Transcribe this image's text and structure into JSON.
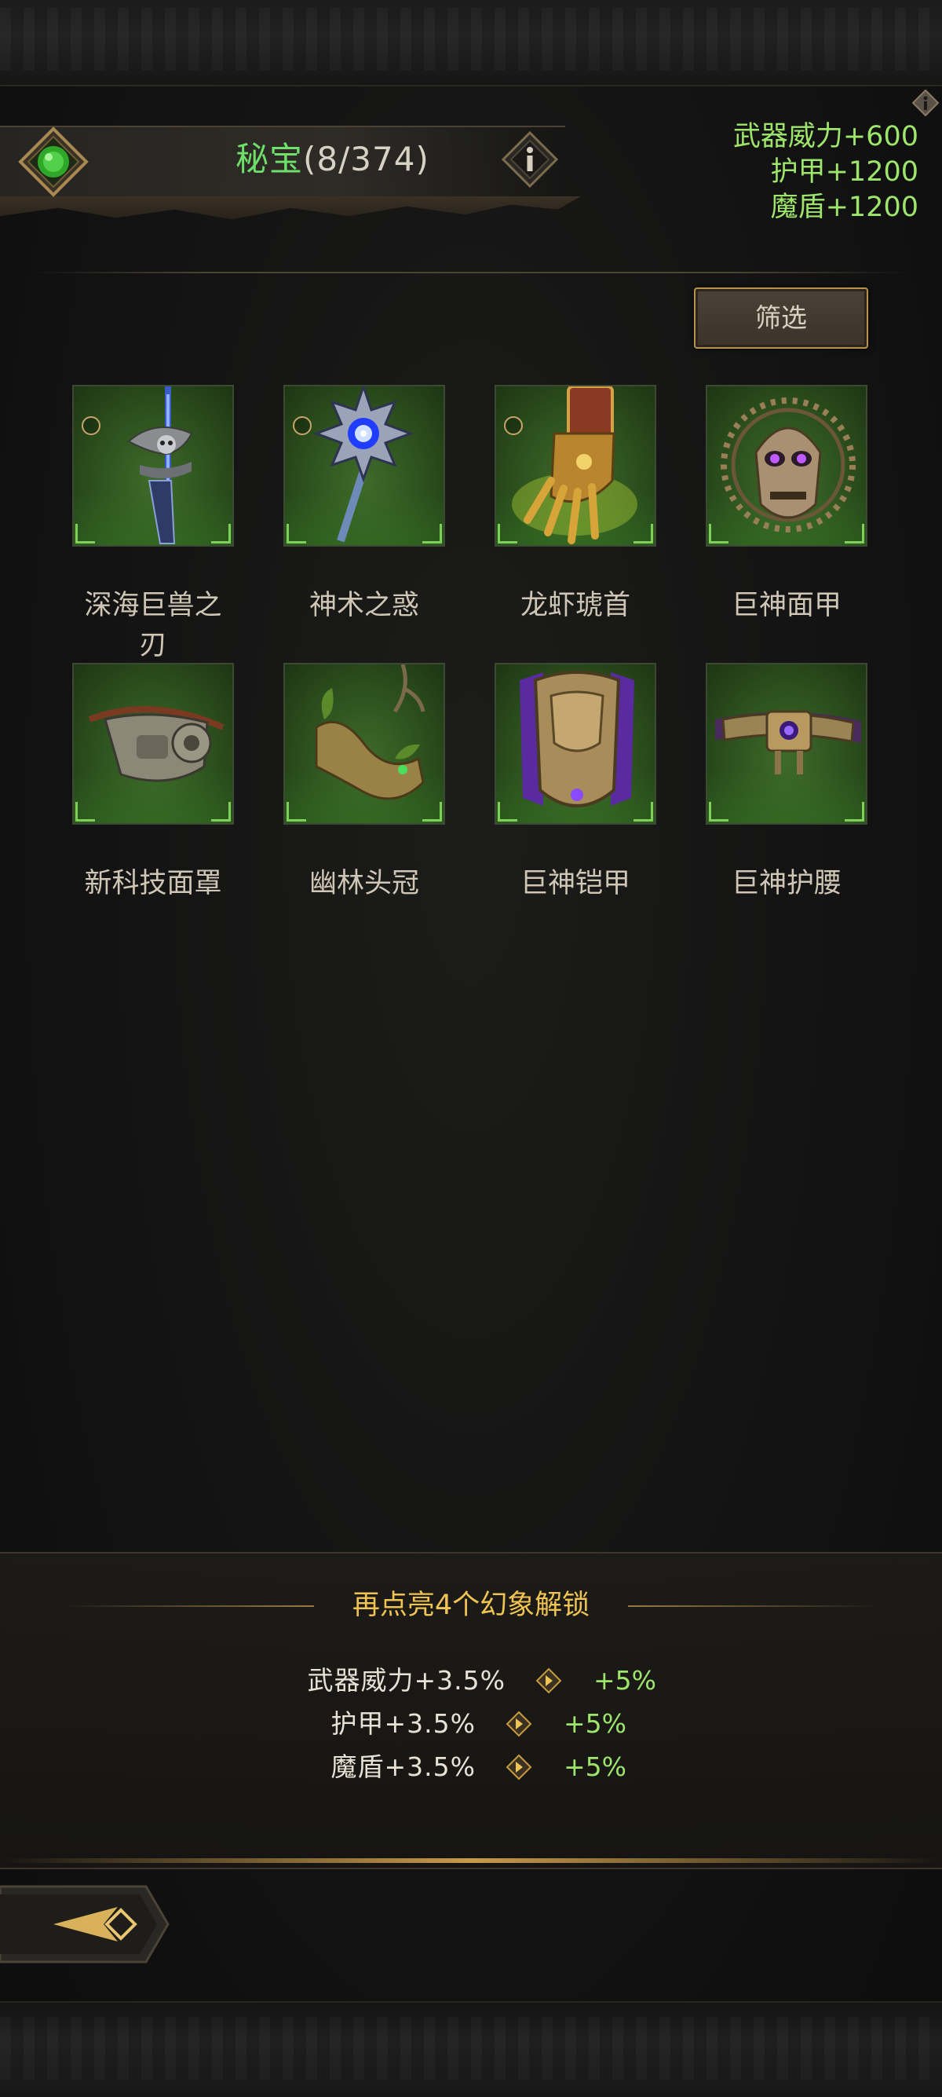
{
  "header": {
    "title": "秘宝",
    "count": "(8/374)"
  },
  "stats": [
    "武器威力+600",
    "护甲+1200",
    "魔盾+1200"
  ],
  "filter_button": {
    "label": "筛选"
  },
  "items": [
    {
      "name": "深海巨兽之刃",
      "marked": true
    },
    {
      "name": "神术之惑",
      "marked": true
    },
    {
      "name": "龙虾琥首",
      "marked": true
    },
    {
      "name": "巨神面甲",
      "marked": false
    },
    {
      "name": "新科技面罩",
      "marked": false
    },
    {
      "name": "幽林头冠",
      "marked": false
    },
    {
      "name": "巨神铠甲",
      "marked": false
    },
    {
      "name": "巨神护腰",
      "marked": false
    }
  ],
  "unlock": {
    "title": "再点亮4个幻象解锁",
    "rows": [
      {
        "label": "武器威力+3.5%",
        "bonus": "+5%"
      },
      {
        "label": "护甲+3.5%",
        "bonus": "+5%"
      },
      {
        "label": "魔盾+3.5%",
        "bonus": "+5%"
      }
    ]
  },
  "colors": {
    "accent_green": "#9ee56c",
    "title_green": "#6ee06a",
    "gold": "#f0c453"
  }
}
